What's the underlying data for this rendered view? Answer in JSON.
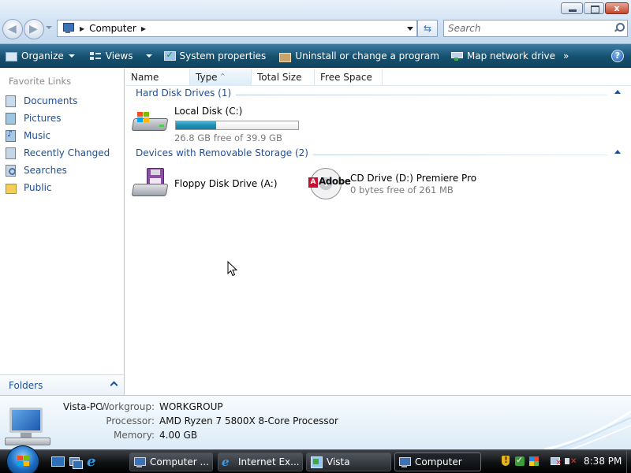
{
  "window": {
    "address": {
      "breadcrumb": "Computer"
    },
    "search": {
      "placeholder": "Search"
    },
    "controls": {
      "close": "x"
    }
  },
  "commandbar": {
    "items": [
      {
        "label": "Organize",
        "icon": "organize-icon"
      },
      {
        "label": "Views",
        "icon": "views-icon"
      },
      {
        "label": "System properties",
        "icon": "system-properties-icon"
      },
      {
        "label": "Uninstall or change a program",
        "icon": "uninstall-icon"
      },
      {
        "label": "Map network drive",
        "icon": "map-network-drive-icon"
      }
    ],
    "more": "»",
    "help": "?"
  },
  "sidebar": {
    "heading": "Favorite Links",
    "items": [
      {
        "label": "Documents",
        "icon": "documents-icon"
      },
      {
        "label": "Pictures",
        "icon": "pictures-icon"
      },
      {
        "label": "Music",
        "icon": "music-icon"
      },
      {
        "label": "Recently Changed",
        "icon": "recently-changed-icon"
      },
      {
        "label": "Searches",
        "icon": "searches-icon"
      },
      {
        "label": "Public",
        "icon": "public-folder-icon"
      }
    ],
    "folders_label": "Folders"
  },
  "columns": [
    "Name",
    "Type",
    "Total Size",
    "Free Space"
  ],
  "groups": [
    {
      "title": "Hard Disk Drives (1)",
      "drives": [
        {
          "name": "Local Disk (C:)",
          "detail": "26.8 GB free of 39.9 GB",
          "used_fraction": 0.33
        }
      ]
    },
    {
      "title": "Devices with Removable Storage (2)",
      "drives": [
        {
          "name": "Floppy Disk Drive (A:)"
        },
        {
          "name": "CD Drive (D:) Premiere Pro",
          "detail": "0 bytes free of 261 MB",
          "logo_text": "Adobe",
          "logo_mark": "A"
        }
      ]
    }
  ],
  "details": {
    "computer_name": "Vista-PC",
    "rows": [
      {
        "label": "Workgroup:",
        "value": "WORKGROUP"
      },
      {
        "label": "Processor:",
        "value": "AMD Ryzen 7 5800X 8-Core Processor"
      },
      {
        "label": "Memory:",
        "value": "4.00 GB"
      }
    ]
  },
  "taskbar": {
    "buttons": [
      {
        "label": "Computer ...",
        "icon": "computer-icon",
        "active": false
      },
      {
        "label": "Internet Ex...",
        "icon": "internet-explorer-icon",
        "active": false
      },
      {
        "label": "Vista",
        "icon": "vista-icon",
        "active": false
      },
      {
        "label": "Computer",
        "icon": "computer-icon",
        "active": true
      }
    ],
    "clock": "8:38 PM"
  },
  "colors": {
    "link": "#1c4f9c",
    "commandbar": "#15506f",
    "capacity_fill": "#1d8fb5",
    "taskbar": "#0f1113"
  }
}
